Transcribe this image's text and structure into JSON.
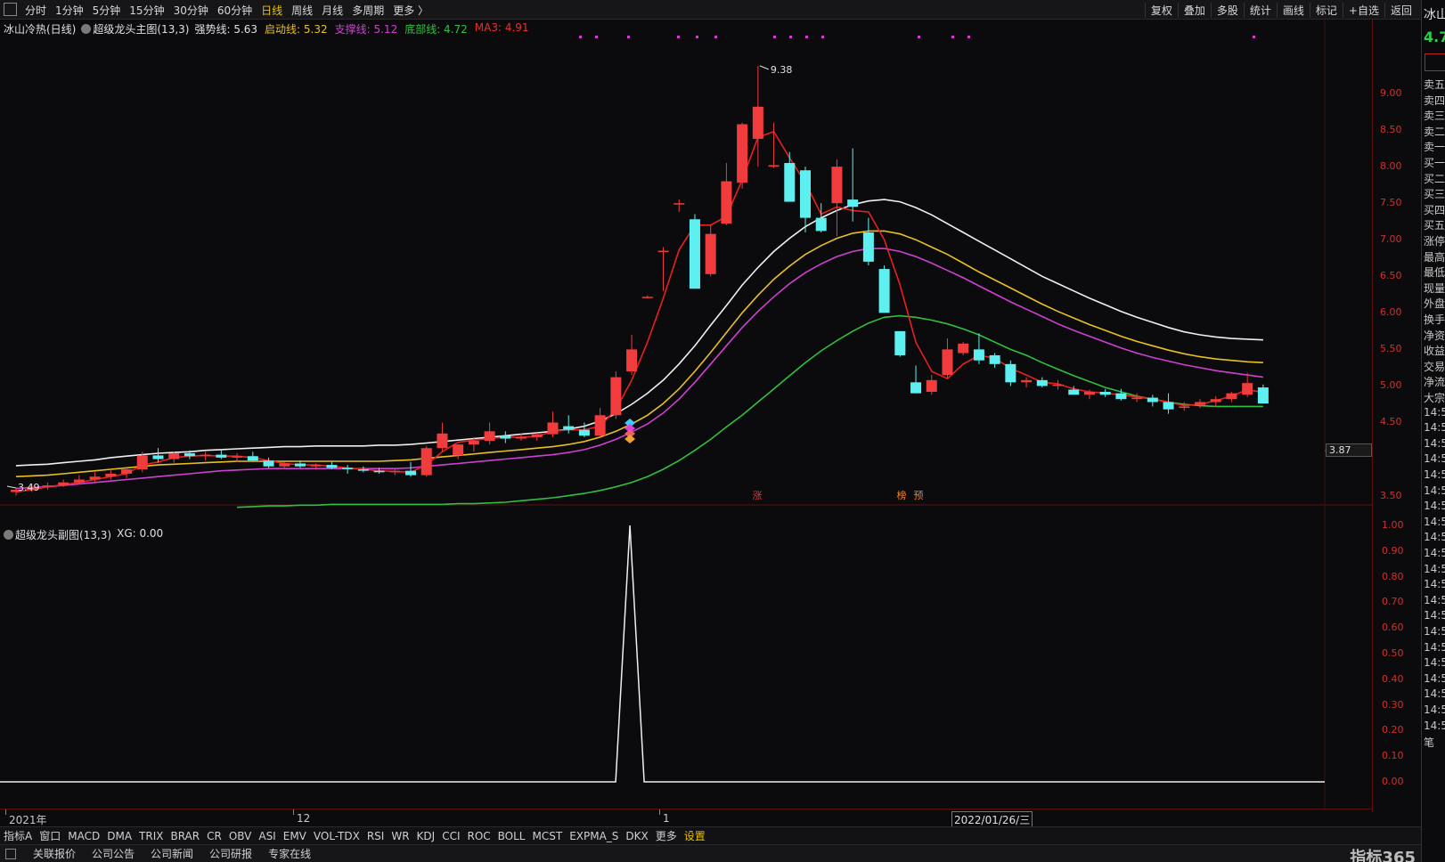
{
  "toolbar": {
    "tabs": [
      "分时",
      "1分钟",
      "5分钟",
      "15分钟",
      "30分钟",
      "60分钟",
      "日线",
      "周线",
      "月线",
      "多周期",
      "更多 〉"
    ],
    "active_tab": "日线",
    "right_buttons": [
      "复权",
      "叠加",
      "多股",
      "统计",
      "画线",
      "标记",
      "+自选",
      "返回"
    ]
  },
  "legend_main": {
    "stock": "冰山冷热(日线)",
    "indicator": "超级龙头主图(13,3)",
    "items": [
      {
        "label": "强势线: 5.63",
        "color": "#e0e0e0"
      },
      {
        "label": "启动线: 5.32",
        "color": "#e8c020"
      },
      {
        "label": "支撑线: 5.12",
        "color": "#d040d0"
      },
      {
        "label": "底部线: 4.72",
        "color": "#30c040"
      },
      {
        "label": "MA3: 4.91",
        "color": "#e83030"
      }
    ]
  },
  "legend_sub": {
    "indicator": "超级龙头副图(13,3)",
    "value": "XG: 0.00"
  },
  "price_axis": {
    "ticks": [
      "9.00",
      "8.50",
      "8.00",
      "7.50",
      "7.00",
      "6.50",
      "6.00",
      "5.50",
      "5.00",
      "4.50",
      "3.50"
    ],
    "cursor_label": "3.87"
  },
  "sub_axis": {
    "ticks": [
      "1.00",
      "0.90",
      "0.80",
      "0.70",
      "0.60",
      "0.50",
      "0.40",
      "0.30",
      "0.20",
      "0.10",
      "0.00"
    ]
  },
  "annotations": {
    "high": "9.38",
    "low": "3.49",
    "tags": [
      "涨",
      "榜",
      "预"
    ]
  },
  "x_axis": {
    "labels": [
      "2021年",
      "12",
      "1"
    ],
    "cursor_date": "2022/01/26/三"
  },
  "bottom_indicators": [
    "指标A",
    "窗口",
    "MACD",
    "DMA",
    "TRIX",
    "BRAR",
    "CR",
    "OBV",
    "ASI",
    "EMV",
    "VOL-TDX",
    "RSI",
    "WR",
    "KDJ",
    "CCI",
    "ROC",
    "BOLL",
    "MCST",
    "EXPMA_S",
    "DKX",
    "更多",
    "设置"
  ],
  "statusbar": {
    "items": [
      "关联报价",
      "公司公告",
      "公司新闻",
      "公司研报",
      "专家在线"
    ],
    "brand": "指标365"
  },
  "right_panel": {
    "title": "冰山",
    "price": "4.7",
    "rows": [
      "卖五",
      "卖四",
      "卖三",
      "卖二",
      "卖一",
      "买一",
      "买二",
      "买三",
      "买四",
      "买五",
      "涨停",
      "最高",
      "最低",
      "现量",
      "外盘",
      "换手",
      "净资",
      "收益",
      "交易",
      "净流",
      "大宗",
      "14:5",
      "14:5",
      "14:5",
      "14:5",
      "14:5",
      "14:5",
      "14:5",
      "14:5",
      "14:5",
      "14:5",
      "14:5",
      "14:5",
      "14:5",
      "14:5",
      "14:5",
      "14:5",
      "14:5",
      "14:5",
      "14:5",
      "14:5",
      "14:5",
      "笔"
    ]
  },
  "colors": {
    "up": "#f03c3c",
    "down": "#5ef0f0",
    "strong": "#f0f0f0",
    "start": "#e8c020",
    "support": "#d040d0",
    "bottom": "#30c040",
    "ma3": "#e82020"
  },
  "chart_data": {
    "type": "candlestick",
    "ylim": [
      3.3,
      9.5
    ],
    "candles": [
      [
        3.55,
        3.6,
        3.5,
        3.58
      ],
      [
        3.58,
        3.66,
        3.55,
        3.62
      ],
      [
        3.62,
        3.68,
        3.58,
        3.64
      ],
      [
        3.64,
        3.72,
        3.62,
        3.68
      ],
      [
        3.68,
        3.78,
        3.66,
        3.72
      ],
      [
        3.72,
        3.82,
        3.68,
        3.76
      ],
      [
        3.76,
        3.86,
        3.72,
        3.8
      ],
      [
        3.8,
        3.88,
        3.74,
        3.86
      ],
      [
        3.86,
        4.1,
        3.82,
        4.05
      ],
      [
        4.05,
        4.15,
        3.95,
        4.0
      ],
      [
        4.0,
        4.1,
        3.95,
        4.08
      ],
      [
        4.08,
        4.12,
        4.0,
        4.04
      ],
      [
        4.04,
        4.1,
        3.98,
        4.06
      ],
      [
        4.06,
        4.12,
        4.0,
        4.02
      ],
      [
        4.02,
        4.08,
        3.96,
        4.04
      ],
      [
        4.04,
        4.1,
        3.98,
        3.98
      ],
      [
        3.98,
        4.02,
        3.88,
        3.9
      ],
      [
        3.9,
        3.96,
        3.86,
        3.94
      ],
      [
        3.94,
        3.98,
        3.88,
        3.9
      ],
      [
        3.9,
        3.94,
        3.86,
        3.92
      ],
      [
        3.92,
        3.96,
        3.86,
        3.88
      ],
      [
        3.88,
        3.92,
        3.8,
        3.86
      ],
      [
        3.86,
        3.9,
        3.82,
        3.84
      ],
      [
        3.84,
        3.88,
        3.8,
        3.82
      ],
      [
        3.82,
        3.86,
        3.78,
        3.84
      ],
      [
        3.84,
        3.96,
        3.76,
        3.78
      ],
      [
        3.78,
        4.18,
        3.76,
        4.15
      ],
      [
        4.15,
        4.5,
        4.1,
        4.35
      ],
      [
        4.05,
        4.2,
        4.0,
        4.2
      ],
      [
        4.2,
        4.3,
        4.1,
        4.25
      ],
      [
        4.25,
        4.5,
        4.2,
        4.38
      ],
      [
        4.32,
        4.38,
        4.22,
        4.28
      ],
      [
        4.28,
        4.35,
        4.25,
        4.3
      ],
      [
        4.3,
        4.36,
        4.25,
        4.34
      ],
      [
        4.34,
        4.65,
        4.3,
        4.5
      ],
      [
        4.45,
        4.6,
        4.35,
        4.4
      ],
      [
        4.4,
        4.5,
        4.3,
        4.32
      ],
      [
        4.32,
        4.7,
        4.3,
        4.6
      ],
      [
        4.6,
        5.2,
        4.55,
        5.12
      ],
      [
        5.2,
        5.7,
        5.15,
        5.5
      ],
      [
        6.22,
        6.24,
        6.2,
        6.22
      ],
      [
        6.85,
        6.9,
        6.3,
        6.85
      ],
      [
        7.5,
        7.55,
        7.38,
        7.5
      ],
      [
        7.28,
        7.35,
        7.25,
        6.33
      ],
      [
        6.53,
        7.2,
        6.5,
        7.08
      ],
      [
        7.22,
        8.05,
        7.2,
        7.8
      ],
      [
        7.78,
        8.6,
        7.7,
        8.58
      ],
      [
        8.38,
        9.38,
        8.0,
        8.82
      ],
      [
        8.0,
        8.6,
        7.98,
        8.02
      ],
      [
        8.05,
        8.2,
        7.55,
        7.52
      ],
      [
        7.95,
        8.0,
        7.1,
        7.3
      ],
      [
        7.3,
        7.5,
        7.1,
        7.12
      ],
      [
        7.5,
        8.1,
        7.05,
        8.0
      ],
      [
        7.55,
        8.25,
        7.25,
        7.45
      ],
      [
        7.1,
        7.3,
        6.65,
        6.7
      ],
      [
        6.6,
        6.65,
        6.0,
        6.0
      ],
      [
        5.75,
        5.75,
        5.4,
        5.42
      ],
      [
        5.05,
        5.28,
        4.9,
        4.9
      ],
      [
        4.92,
        5.15,
        4.88,
        5.08
      ],
      [
        5.15,
        5.65,
        5.1,
        5.5
      ],
      [
        5.45,
        5.6,
        5.42,
        5.58
      ],
      [
        5.5,
        5.72,
        5.3,
        5.35
      ],
      [
        5.42,
        5.45,
        5.25,
        5.3
      ],
      [
        5.3,
        5.35,
        5.0,
        5.05
      ],
      [
        5.05,
        5.12,
        4.98,
        5.08
      ],
      [
        5.08,
        5.12,
        4.98,
        5.0
      ],
      [
        5.0,
        5.08,
        4.95,
        5.02
      ],
      [
        4.95,
        5.0,
        4.88,
        4.88
      ],
      [
        4.88,
        4.95,
        4.82,
        4.92
      ],
      [
        4.92,
        4.96,
        4.85,
        4.88
      ],
      [
        4.9,
        4.96,
        4.8,
        4.82
      ],
      [
        4.82,
        4.9,
        4.78,
        4.84
      ],
      [
        4.84,
        4.88,
        4.72,
        4.78
      ],
      [
        4.78,
        4.9,
        4.62,
        4.68
      ],
      [
        4.7,
        4.78,
        4.66,
        4.72
      ],
      [
        4.74,
        4.82,
        4.7,
        4.78
      ],
      [
        4.78,
        4.86,
        4.72,
        4.82
      ],
      [
        4.82,
        4.92,
        4.78,
        4.9
      ],
      [
        4.88,
        5.18,
        4.85,
        5.04
      ],
      [
        4.98,
        5.02,
        4.76,
        4.76
      ]
    ],
    "lines": {
      "strong": [
        3.91,
        3.92,
        3.93,
        3.95,
        3.97,
        3.99,
        4.02,
        4.04,
        4.06,
        4.08,
        4.09,
        4.1,
        4.12,
        4.13,
        4.14,
        4.15,
        4.16,
        4.17,
        4.17,
        4.18,
        4.18,
        4.18,
        4.18,
        4.19,
        4.19,
        4.2,
        4.22,
        4.24,
        4.26,
        4.28,
        4.3,
        4.32,
        4.34,
        4.36,
        4.38,
        4.41,
        4.45,
        4.52,
        4.62,
        4.75,
        4.9,
        5.08,
        5.3,
        5.55,
        5.83,
        6.1,
        6.38,
        6.62,
        6.84,
        7.02,
        7.18,
        7.3,
        7.4,
        7.48,
        7.53,
        7.55,
        7.52,
        7.44,
        7.34,
        7.22,
        7.1,
        6.98,
        6.86,
        6.74,
        6.62,
        6.5,
        6.4,
        6.3,
        6.2,
        6.11,
        6.02,
        5.94,
        5.87,
        5.8,
        5.74,
        5.7,
        5.67,
        5.65,
        5.64,
        5.63
      ],
      "start": [
        3.76,
        3.77,
        3.78,
        3.8,
        3.82,
        3.84,
        3.86,
        3.88,
        3.9,
        3.92,
        3.93,
        3.94,
        3.95,
        3.96,
        3.97,
        3.97,
        3.97,
        3.97,
        3.97,
        3.97,
        3.97,
        3.97,
        3.97,
        3.97,
        3.98,
        3.99,
        4.01,
        4.03,
        4.05,
        4.07,
        4.09,
        4.11,
        4.13,
        4.15,
        4.17,
        4.2,
        4.24,
        4.3,
        4.38,
        4.48,
        4.6,
        4.76,
        4.96,
        5.2,
        5.46,
        5.73,
        6.0,
        6.24,
        6.46,
        6.64,
        6.8,
        6.92,
        7.02,
        7.09,
        7.12,
        7.12,
        7.08,
        7.0,
        6.9,
        6.8,
        6.68,
        6.56,
        6.45,
        6.34,
        6.23,
        6.12,
        6.02,
        5.93,
        5.84,
        5.76,
        5.68,
        5.61,
        5.55,
        5.49,
        5.44,
        5.4,
        5.37,
        5.35,
        5.33,
        5.32
      ],
      "support": [
        3.6,
        3.61,
        3.62,
        3.64,
        3.66,
        3.68,
        3.7,
        3.72,
        3.74,
        3.76,
        3.78,
        3.8,
        3.82,
        3.84,
        3.85,
        3.86,
        3.87,
        3.87,
        3.87,
        3.87,
        3.87,
        3.87,
        3.87,
        3.87,
        3.87,
        3.88,
        3.9,
        3.92,
        3.94,
        3.96,
        3.98,
        4.0,
        4.02,
        4.04,
        4.06,
        4.09,
        4.13,
        4.19,
        4.27,
        4.37,
        4.48,
        4.63,
        4.82,
        5.05,
        5.3,
        5.55,
        5.8,
        6.02,
        6.22,
        6.4,
        6.55,
        6.67,
        6.77,
        6.84,
        6.88,
        6.88,
        6.84,
        6.77,
        6.68,
        6.58,
        6.48,
        6.37,
        6.26,
        6.15,
        6.05,
        5.95,
        5.85,
        5.76,
        5.68,
        5.6,
        5.52,
        5.45,
        5.39,
        5.34,
        5.29,
        5.25,
        5.21,
        5.18,
        5.15,
        5.12
      ],
      "bottom": [
        null,
        null,
        null,
        null,
        null,
        null,
        null,
        null,
        null,
        null,
        null,
        null,
        null,
        null,
        3.34,
        3.35,
        3.36,
        3.36,
        3.37,
        3.37,
        3.38,
        3.38,
        3.38,
        3.38,
        3.38,
        3.38,
        3.38,
        3.38,
        3.39,
        3.39,
        3.4,
        3.41,
        3.43,
        3.45,
        3.47,
        3.5,
        3.53,
        3.57,
        3.62,
        3.68,
        3.76,
        3.86,
        3.98,
        4.12,
        4.27,
        4.44,
        4.6,
        4.78,
        4.96,
        5.14,
        5.32,
        5.48,
        5.62,
        5.75,
        5.86,
        5.94,
        5.96,
        5.94,
        5.9,
        5.85,
        5.78,
        5.7,
        5.6,
        5.5,
        5.42,
        5.32,
        5.23,
        5.14,
        5.06,
        4.98,
        4.92,
        4.86,
        4.82,
        4.78,
        4.75,
        4.73,
        4.72,
        4.72,
        4.72,
        4.72
      ],
      "ma3": [
        3.55,
        3.58,
        3.62,
        3.65,
        3.68,
        3.72,
        3.76,
        3.8,
        3.92,
        3.96,
        4.02,
        4.04,
        4.05,
        4.04,
        4.04,
        4.02,
        3.98,
        3.94,
        3.92,
        3.92,
        3.9,
        3.88,
        3.86,
        3.84,
        3.83,
        3.82,
        3.92,
        4.1,
        4.23,
        4.26,
        4.28,
        4.3,
        4.3,
        4.31,
        4.38,
        4.4,
        4.4,
        4.45,
        4.68,
        5.08,
        5.6,
        6.2,
        6.86,
        7.2,
        7.2,
        7.32,
        7.82,
        8.4,
        8.48,
        8.12,
        7.78,
        7.35,
        7.45,
        7.4,
        7.38,
        7.0,
        6.38,
        5.6,
        5.2,
        5.1,
        5.3,
        5.42,
        5.38,
        5.24,
        5.15,
        5.05,
        5.03,
        4.96,
        4.92,
        4.9,
        4.88,
        4.85,
        4.82,
        4.78,
        4.73,
        4.75,
        4.8,
        4.86,
        4.95,
        4.91
      ]
    },
    "signal": {
      "index": 39,
      "value": 1.0
    },
    "sub_ylim": [
      0,
      1.0
    ]
  }
}
